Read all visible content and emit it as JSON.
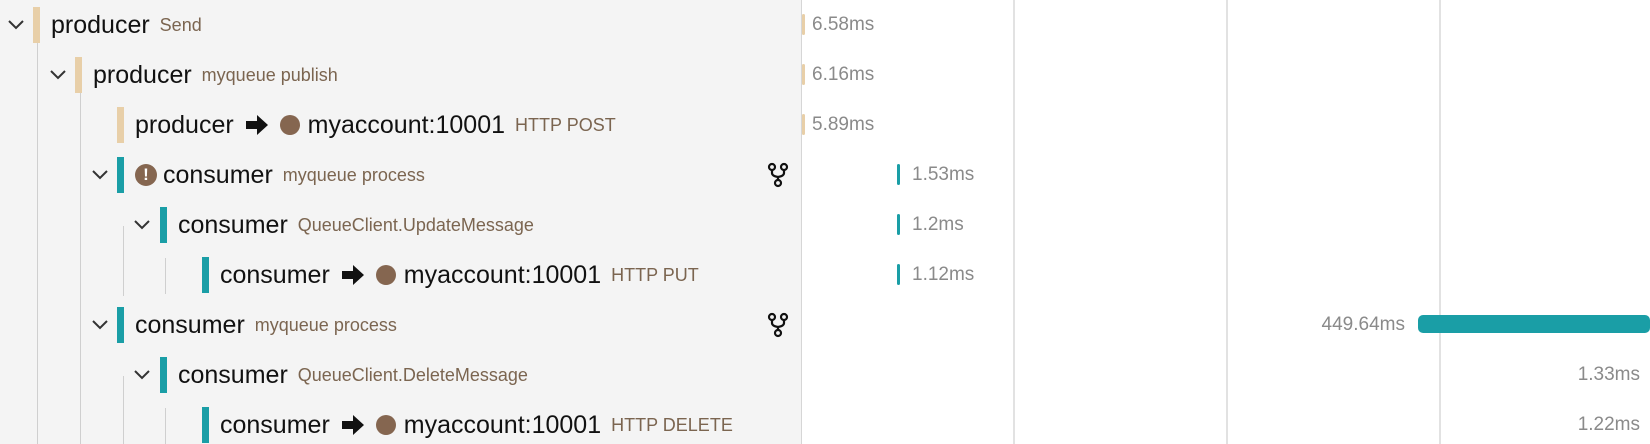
{
  "colors": {
    "producer": "#e8cfa8",
    "consumer": "#1a9ea6",
    "duration_text": "#8a8a8a",
    "op_text": "#7b6550"
  },
  "icons": {
    "chevron": "chevron-down-icon",
    "arrow": "arrow-right-icon",
    "host": "circle-icon",
    "error": "error-icon",
    "fork": "fork-icon"
  },
  "spans": [
    {
      "service": "producer",
      "operation": "Send",
      "duration": "6.58ms",
      "kind": "producer"
    },
    {
      "service": "producer",
      "operation": "myqueue publish",
      "duration": "6.16ms",
      "kind": "producer"
    },
    {
      "service": "producer",
      "target": "myaccount:10001",
      "operation": "HTTP POST",
      "duration": "5.89ms",
      "kind": "producer"
    },
    {
      "service": "consumer",
      "operation": "myqueue process",
      "duration": "1.53ms",
      "kind": "consumer",
      "error": true,
      "error_symbol": "!"
    },
    {
      "service": "consumer",
      "operation": "QueueClient.UpdateMessage",
      "duration": "1.2ms",
      "kind": "consumer"
    },
    {
      "service": "consumer",
      "target": "myaccount:10001",
      "operation": "HTTP PUT",
      "duration": "1.12ms",
      "kind": "consumer"
    },
    {
      "service": "consumer",
      "operation": "myqueue process",
      "duration": "449.64ms",
      "kind": "consumer"
    },
    {
      "service": "consumer",
      "operation": "QueueClient.DeleteMessage",
      "duration": "1.33ms",
      "kind": "consumer"
    },
    {
      "service": "consumer",
      "target": "myaccount:10001",
      "operation": "HTTP DELETE",
      "duration": "1.22ms",
      "kind": "consumer"
    }
  ]
}
